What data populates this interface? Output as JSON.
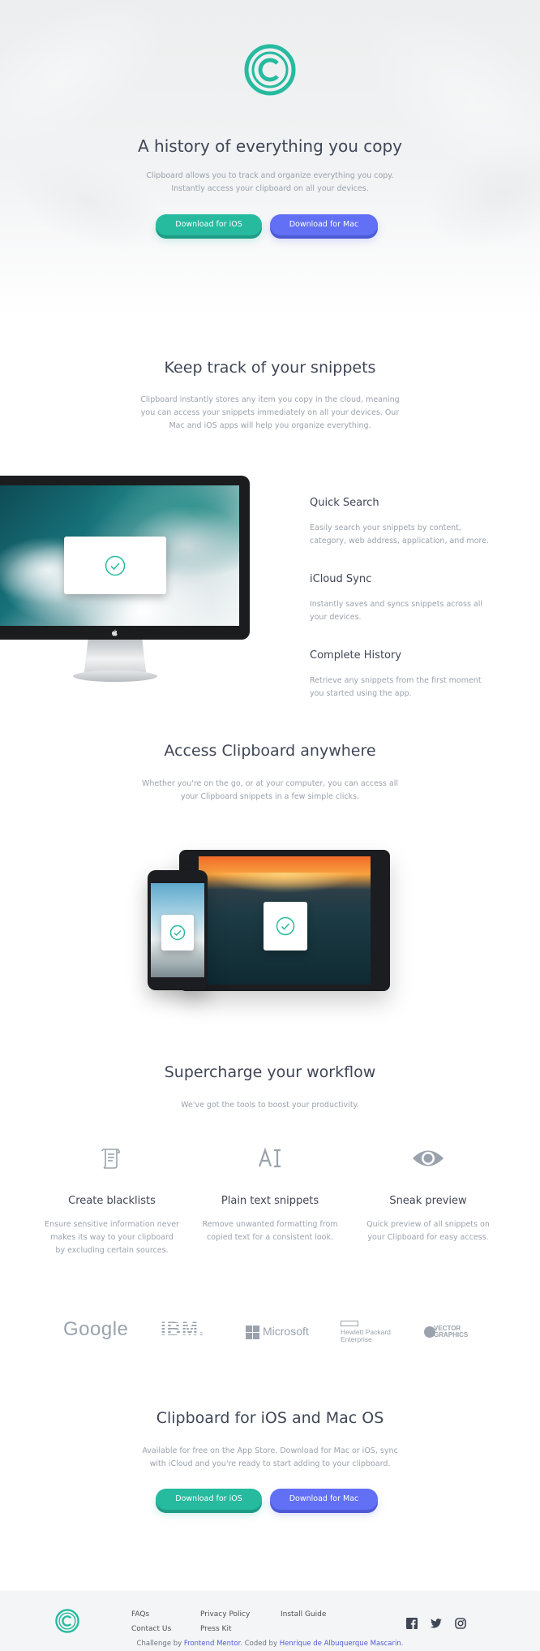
{
  "hero": {
    "title": "A history of everything you copy",
    "subtitle_line1": "Clipboard allows you to track and organize everything you copy.",
    "subtitle_line2": "Instantly access your clipboard on all your devices.",
    "btn_ios": "Download for iOS",
    "btn_mac": "Download for Mac"
  },
  "snippets": {
    "title": "Keep track of your snippets",
    "text_line1": "Clipboard instantly stores any item you copy in the cloud, meaning",
    "text_line2": "you can access your snippets immediately on all your devices. Our",
    "text_line3": "Mac and iOS apps will help you organize everything.",
    "features": [
      {
        "title": "Quick Search",
        "line1": "Easily search your snippets by content,",
        "line2": "category, web address, application, and more."
      },
      {
        "title": "iCloud Sync",
        "line1": "Instantly saves and syncs snippets across all",
        "line2": "your devices."
      },
      {
        "title": "Complete History",
        "line1": "Retrieve any snippets from the first moment",
        "line2": "you started using the app."
      }
    ]
  },
  "access": {
    "title": "Access Clipboard anywhere",
    "text_line1": "Whether you're on the go, or at your computer, you can access all",
    "text_line2": "your Clipboard snippets in a few simple clicks."
  },
  "workflow": {
    "title": "Supercharge your workflow",
    "subtitle": "We've got the tools to boost your productivity.",
    "items": [
      {
        "icon": "document-list-icon",
        "title": "Create blacklists",
        "line1": "Ensure sensitive information never",
        "line2": "makes its way to your clipboard",
        "line3": "by excluding certain sources."
      },
      {
        "icon": "text-cursor-icon",
        "title": "Plain text snippets",
        "line1": "Remove unwanted formatting from",
        "line2": "copied text for a consistent look.",
        "line3": ""
      },
      {
        "icon": "eye-icon",
        "title": "Sneak preview",
        "line1": "Quick preview of all snippets on",
        "line2": "your Clipboard for easy access.",
        "line3": ""
      }
    ]
  },
  "brands": {
    "google": "Google",
    "ibm": "IBM.",
    "microsoft": "Microsoft",
    "hp_line1": "Hewlett Packard",
    "hp_line2": "Enterprise",
    "vector_line1": "VECTOR",
    "vector_line2": "GRAPHICS"
  },
  "cta": {
    "title": "Clipboard for iOS and Mac OS",
    "text_line1": "Available for free on the App Store. Download for Mac or iOS, sync",
    "text_line2": "with iCloud and you're ready to start adding to your clipboard.",
    "btn_ios": "Download for iOS",
    "btn_mac": "Download for Mac"
  },
  "footer": {
    "links": [
      "FAQs",
      "Privacy Policy",
      "Install Guide",
      "Contact Us",
      "Press Kit"
    ],
    "credit_prefix": "Challenge by ",
    "credit_fm": "Frontend Mentor",
    "credit_mid": ". Coded by ",
    "credit_author": "Henrique de Albuquerque Mascarin",
    "credit_suffix": "."
  },
  "colors": {
    "accent_green": "#26ba9f",
    "accent_blue": "#6170f5",
    "heading": "#3f4656",
    "body_text": "#9aa3ad"
  }
}
